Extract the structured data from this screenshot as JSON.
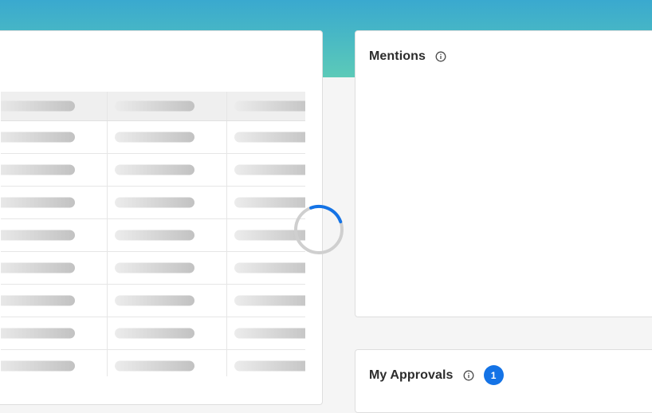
{
  "colors": {
    "header_gradient_top": "#3aa9cf",
    "header_gradient_bottom": "#5ccab8",
    "spinner_accent": "#1473e6",
    "badge": "#1473e6"
  },
  "loading_table": {
    "state": "loading",
    "icon": "loading-spinner-icon"
  },
  "mentions": {
    "title": "Mentions",
    "info_icon": "info-icon"
  },
  "approvals": {
    "title": "My Approvals",
    "info_icon": "info-icon",
    "count": "1"
  }
}
